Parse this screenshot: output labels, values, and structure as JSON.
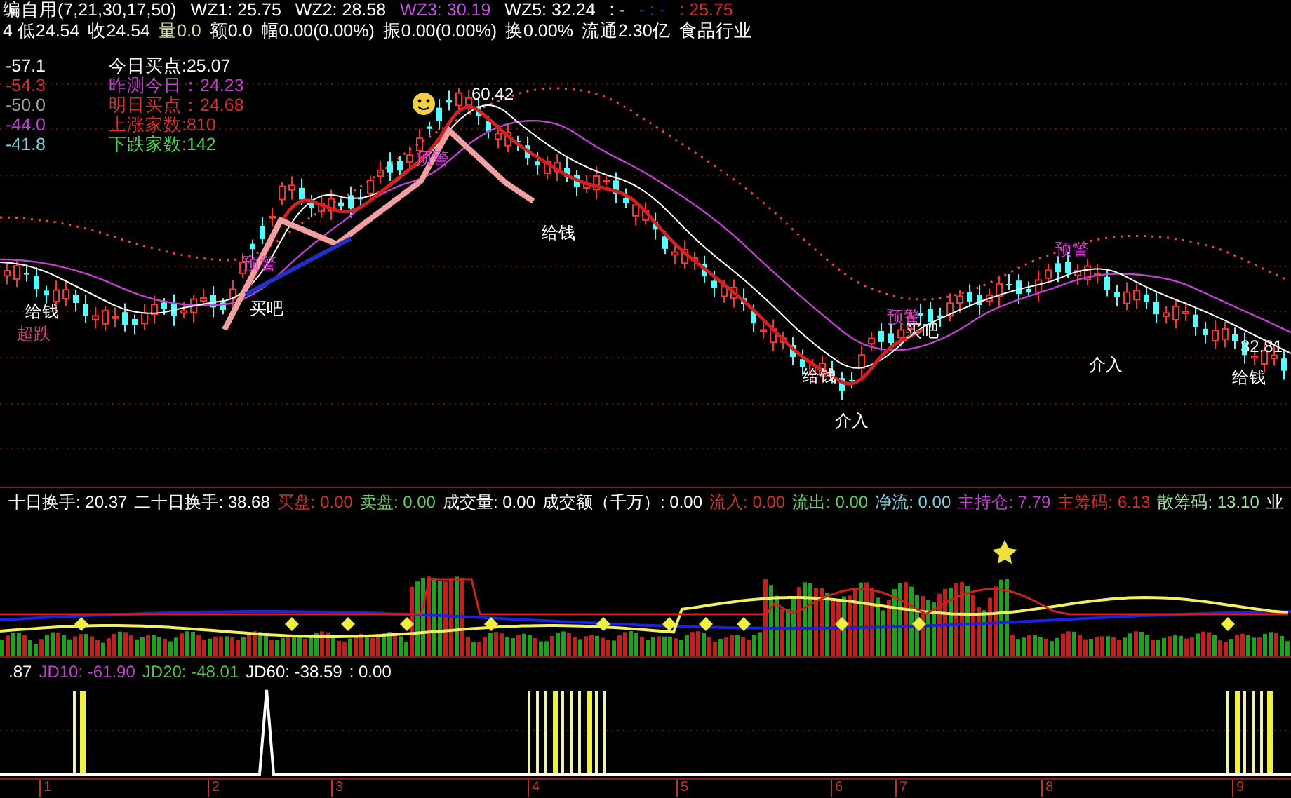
{
  "header_line_1": [
    {
      "text": "编自用(7,21,30,17,50)",
      "color": "#ffffff"
    },
    {
      "text": "WZ1: 25.75",
      "color": "#ffffff"
    },
    {
      "text": "WZ2: 28.58",
      "color": "#ffffff"
    },
    {
      "text": "WZ3: 30.19",
      "color": "#c050e0"
    },
    {
      "text": "WZ5: 32.24",
      "color": "#ffffff"
    },
    {
      "text": ": -",
      "color": "#ffffff"
    },
    {
      "text": "- : -",
      "color": "#3040a0"
    },
    {
      "text": ": 25.75",
      "color": "#d03030"
    }
  ],
  "header_line_2": [
    {
      "text": "4 低24.54",
      "color": "#ffffff"
    },
    {
      "text": "收24.54",
      "color": "#ffffff"
    },
    {
      "text": "量0.0",
      "color": "#d8d8a0"
    },
    {
      "text": "额0.0",
      "color": "#ffffff"
    },
    {
      "text": "幅0.00(0.00%)",
      "color": "#ffffff"
    },
    {
      "text": "振0.00(0.00%)",
      "color": "#ffffff"
    },
    {
      "text": "换0.00%",
      "color": "#ffffff"
    },
    {
      "text": "流通2.30亿",
      "color": "#ffffff"
    },
    {
      "text": "食品行业",
      "color": "#ffffff"
    }
  ],
  "legend_left": [
    {
      "text": "-57.1",
      "color": "#ffffff"
    },
    {
      "text": "-54.3",
      "color": "#d03030"
    },
    {
      "text": "-50.0",
      "color": "#a0a0a0"
    },
    {
      "text": "-44.0",
      "color": "#c040d0"
    },
    {
      "text": "-41.8",
      "color": "#80d0e0"
    }
  ],
  "legend_right": [
    {
      "text": "今日买点:25.07",
      "color": "#ffffff"
    },
    {
      "text": "昨测今日：24.23",
      "color": "#c040d0"
    },
    {
      "text": "明日买点：24.68",
      "color": "#d03030"
    },
    {
      "text": "上涨家数:810",
      "color": "#d03030"
    },
    {
      "text": "下跌家数:142",
      "color": "#50d050"
    }
  ],
  "chart_labels": [
    {
      "text": "60.42",
      "color": "#ffffff"
    },
    {
      "text": "预警",
      "color": "#d040d0"
    },
    {
      "text": "给钱",
      "color": "#ffffff"
    },
    {
      "text": "超跌",
      "color": "#d04080"
    },
    {
      "text": "买吧",
      "color": "#ffffff"
    },
    {
      "text": "预警",
      "color": "#d040d0"
    },
    {
      "text": "给钱",
      "color": "#ffffff"
    },
    {
      "text": "给钱",
      "color": "#ffffff"
    },
    {
      "text": "介入",
      "color": "#ffffff"
    },
    {
      "text": "预警",
      "color": "#d040d0"
    },
    {
      "text": "买吧",
      "color": "#ffffff"
    },
    {
      "text": "预警",
      "color": "#d040d0"
    },
    {
      "text": "介入",
      "color": "#ffffff"
    },
    {
      "text": "给钱",
      "color": "#ffffff"
    },
    {
      "text": "32.81",
      "color": "#ffffff"
    }
  ],
  "indicator_bar": [
    {
      "text": "十日换手: 20.37",
      "color": "#ffffff"
    },
    {
      "text": "二十日换手: 38.68",
      "color": "#ffffff"
    },
    {
      "text": "买盘: 0.00",
      "color": "#d03030"
    },
    {
      "text": "卖盘: 0.00",
      "color": "#60d060"
    },
    {
      "text": "成交量: 0.00",
      "color": "#ffffff"
    },
    {
      "text": "成交额（千万）: 0.00",
      "color": "#ffffff"
    },
    {
      "text": "流入: 0.00",
      "color": "#d03030"
    },
    {
      "text": "流出: 0.00",
      "color": "#60d060"
    },
    {
      "text": "净流: 0.00",
      "color": "#80d0e0"
    },
    {
      "text": "主持仓: 7.79",
      "color": "#c040d0"
    },
    {
      "text": "主筹码: 6.13",
      "color": "#d03030"
    },
    {
      "text": "散筹码: 13.10",
      "color": "#a0e0a0"
    },
    {
      "text": "业",
      "color": "#ffffff"
    }
  ],
  "jd_bar": [
    {
      "text": ".87",
      "color": "#ffffff"
    },
    {
      "text": "JD10: -61.90",
      "color": "#c040d0"
    },
    {
      "text": "JD20: -48.01",
      "color": "#50c050"
    },
    {
      "text": "JD60: -38.59",
      "color": "#ffffff"
    },
    {
      "text": ": 0.00",
      "color": "#ffffff"
    }
  ],
  "x_axis": [
    "1",
    "2",
    "3",
    "4",
    "5",
    "6",
    "7",
    "8",
    "9"
  ]
}
